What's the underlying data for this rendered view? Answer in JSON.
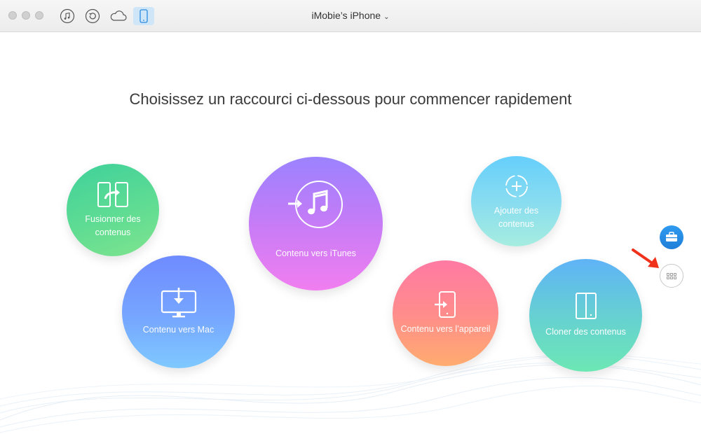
{
  "window": {
    "device_title": "iMobie’s iPhone",
    "toolbar": [
      {
        "name": "music-icon",
        "active": false
      },
      {
        "name": "restore-icon",
        "active": false
      },
      {
        "name": "cloud-icon",
        "active": false
      },
      {
        "name": "iphone-icon",
        "active": true
      }
    ]
  },
  "main": {
    "headline": "Choisissez un raccourci ci-dessous pour commencer rapidement",
    "shortcuts": [
      {
        "label": "Fusionner des contenus",
        "icon": "merge-icon",
        "color": "#4fd898"
      },
      {
        "label": "Contenu vers Mac",
        "icon": "mac-download-icon",
        "color": "#76a6ff"
      },
      {
        "label": "Contenu vers iTunes",
        "icon": "itunes-icon",
        "color": "#c27cf7"
      },
      {
        "label": "Ajouter des contenus",
        "icon": "add-icon",
        "color": "#88dcf0"
      },
      {
        "label": "Contenu vers l’appareil",
        "icon": "to-device-icon",
        "color": "#ff8c8c"
      },
      {
        "label": "Cloner des contenus",
        "icon": "clone-icon",
        "color": "#66d0d2"
      }
    ],
    "side_buttons": [
      {
        "name": "toolkit-button",
        "icon": "briefcase-icon",
        "color": "#2389e2"
      },
      {
        "name": "grid-view-button",
        "icon": "grid-icon"
      }
    ],
    "annotation": {
      "icon": "red-arrow",
      "color": "#f0321c"
    }
  }
}
